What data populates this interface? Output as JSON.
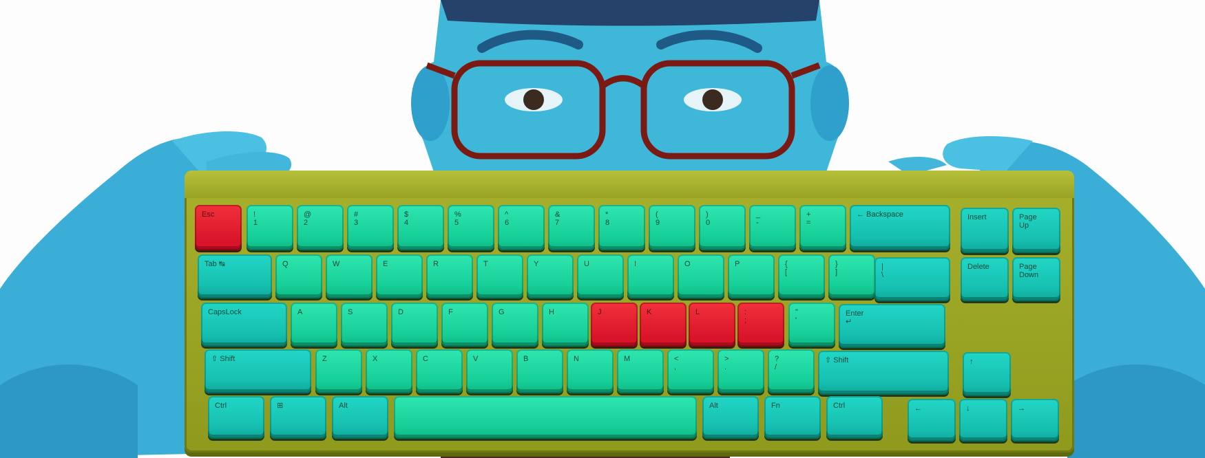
{
  "image": {
    "subject": "keyboard held in front of face",
    "colors": {
      "background": "#fdfdfd",
      "skin": "#3fb7d9",
      "skin_shadow": "#1f7fb2",
      "case": "#9aa51f",
      "keycap": "#1fd9a3",
      "modifier_keycap": "#1fcbbb",
      "accent_keycap": "#e3162b",
      "glasses": "#7a1a12"
    }
  },
  "keyboard": {
    "rows": [
      [
        "Esc",
        "!\n1",
        "@\n2",
        "#\n3",
        "$\n4",
        "%\n5",
        "^\n6",
        "&\n7",
        "*\n8",
        "(\n9",
        ")\n0",
        "_\n-",
        "+\n=",
        "← Backspace",
        "Insert",
        "Page\nUp"
      ],
      [
        "Tab ↹",
        "Q",
        "W",
        "E",
        "R",
        "T",
        "Y",
        "U",
        "I",
        "O",
        "P",
        "{\n[",
        "}\n]",
        "|\n\\",
        "Delete",
        "Page\nDown"
      ],
      [
        "CapsLock",
        "A",
        "S",
        "D",
        "F",
        "G",
        "H",
        "J",
        "K",
        "L",
        ":\n;",
        "\"\n'",
        "Enter\n↵"
      ],
      [
        "⇧ Shift",
        "Z",
        "X",
        "C",
        "V",
        "B",
        "N",
        "M",
        "<\n,",
        ">\n.",
        "?\n/",
        "⇧ Shift",
        "↑"
      ],
      [
        "Ctrl",
        "⊞",
        "Alt",
        "",
        "Alt",
        "Fn",
        "Ctrl",
        "←",
        "↓",
        "→"
      ]
    ]
  }
}
